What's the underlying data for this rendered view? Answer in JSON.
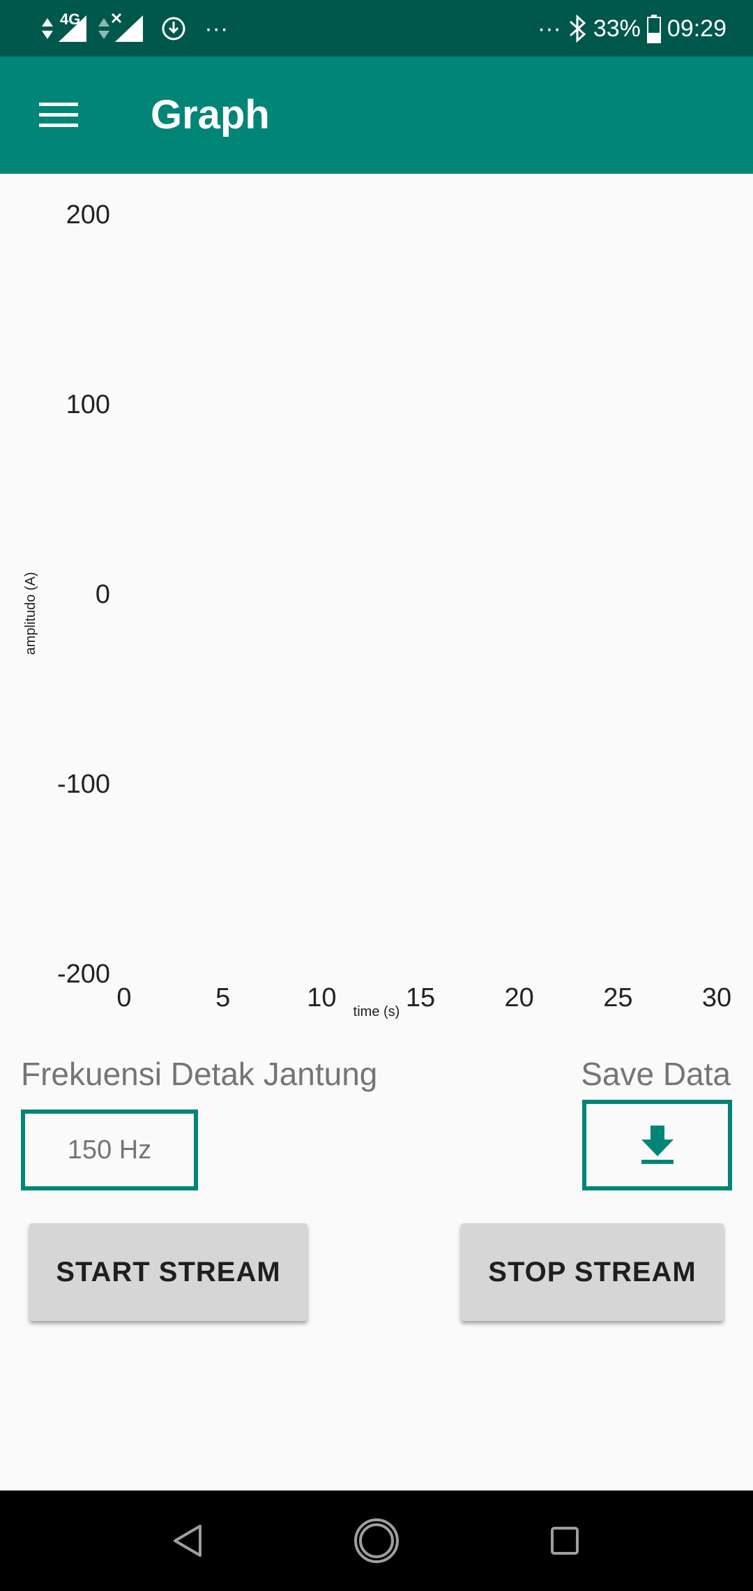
{
  "status_bar": {
    "network": "4G",
    "more_left": "···",
    "more_right": "···",
    "battery": "33%",
    "time": "09:29"
  },
  "app_bar": {
    "title": "Graph"
  },
  "chart_data": {
    "type": "line",
    "series": [],
    "xlabel": "time (s)",
    "ylabel": "amplitudo (A)",
    "xlim": [
      0,
      30
    ],
    "ylim": [
      -200,
      200
    ],
    "x_ticks": [
      "0",
      "5",
      "10",
      "15",
      "20",
      "25",
      "30"
    ],
    "y_ticks": [
      "200",
      "100",
      "0",
      "-100",
      "-200"
    ],
    "grid": false
  },
  "heart_rate": {
    "label": "Frekuensi Detak Jantung",
    "value": "150 Hz"
  },
  "save": {
    "label": "Save Data"
  },
  "buttons": {
    "start": "START STREAM",
    "stop": "STOP STREAM"
  },
  "colors": {
    "primary": "#008577",
    "primary_dark": "#00574b"
  }
}
